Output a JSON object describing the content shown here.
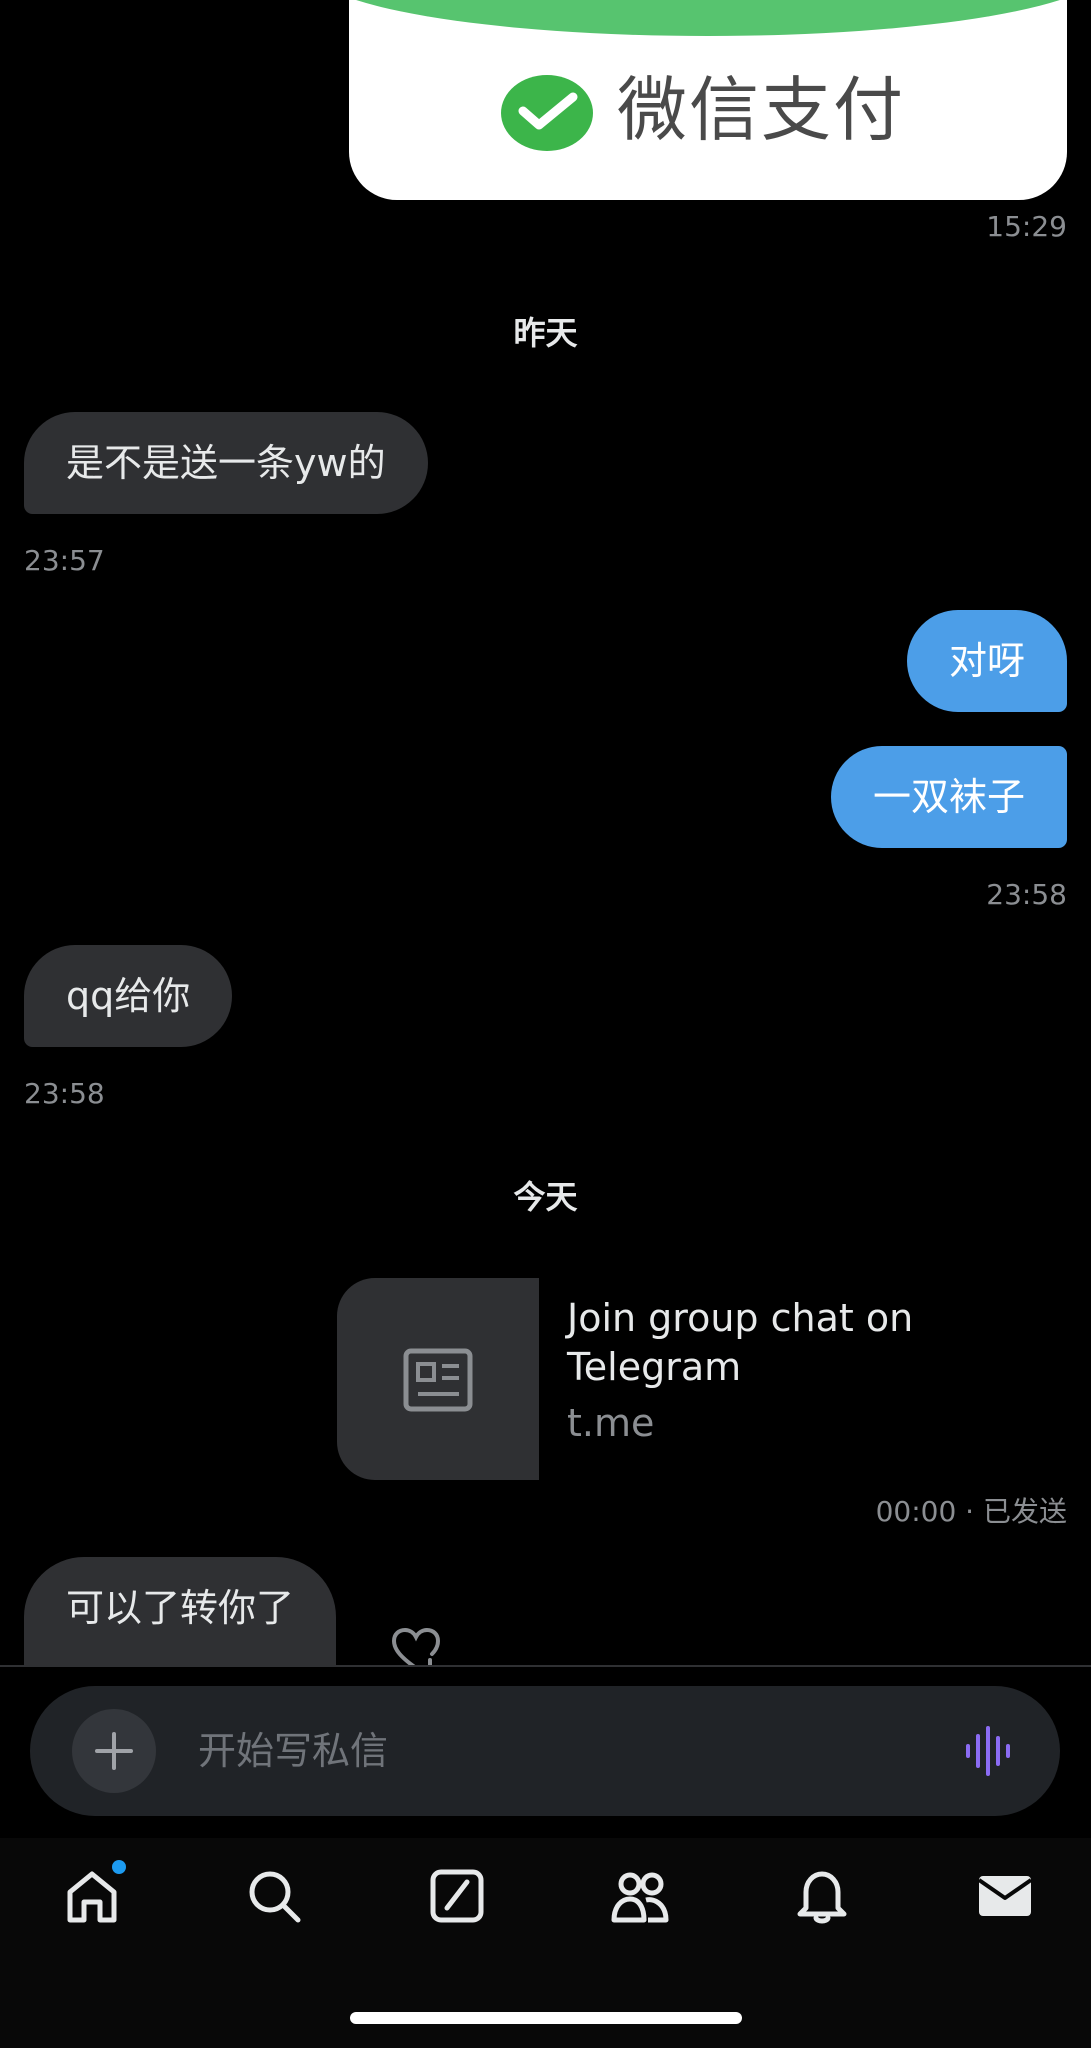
{
  "pay_card": {
    "text": "微信支付",
    "logo_icon": "wechat-pay-icon",
    "colors": {
      "band": "#57c46f",
      "card": "#ffffff",
      "text": "#4a4a4a"
    }
  },
  "conversation": {
    "items": [
      {
        "kind": "time",
        "side": "right",
        "text": "15:29"
      },
      {
        "kind": "day",
        "text": "昨天"
      },
      {
        "kind": "message",
        "side": "in",
        "text": "是不是送一条yw的"
      },
      {
        "kind": "time",
        "side": "left",
        "text": "23:57"
      },
      {
        "kind": "message",
        "side": "out",
        "text": "对呀"
      },
      {
        "kind": "message",
        "side": "out",
        "text": "一双袜子"
      },
      {
        "kind": "time",
        "side": "right",
        "text": "23:58"
      },
      {
        "kind": "message",
        "side": "in",
        "text": "qq给你"
      },
      {
        "kind": "time",
        "side": "left",
        "text": "23:58"
      },
      {
        "kind": "day",
        "text": "今天"
      },
      {
        "kind": "time",
        "side": "right",
        "text": "00:00 · 已发送"
      },
      {
        "kind": "message",
        "side": "in",
        "text": "可以了转你了"
      }
    ],
    "link_card": {
      "title": "Join group chat on Telegram",
      "domain": "t.me",
      "thumb_icon": "article-icon"
    }
  },
  "composer": {
    "placeholder": "开始写私信",
    "value": "",
    "plus_icon": "plus-icon",
    "voice_icon": "voice-wave-icon"
  },
  "nav": {
    "items": [
      {
        "name": "home",
        "icon": "home-icon",
        "badge": true
      },
      {
        "name": "search",
        "icon": "search-icon"
      },
      {
        "name": "grok",
        "icon": "grok-icon"
      },
      {
        "name": "communities",
        "icon": "people-icon"
      },
      {
        "name": "notifications",
        "icon": "bell-icon"
      },
      {
        "name": "messages",
        "icon": "mail-icon",
        "active": true
      }
    ]
  },
  "colors": {
    "background": "#000000",
    "bubble_in": "#2f3033",
    "bubble_out": "#4c9ee8",
    "timestamp": "#8b8e92",
    "accent": "#1d9bf0",
    "voice": "#8b6cf3"
  }
}
